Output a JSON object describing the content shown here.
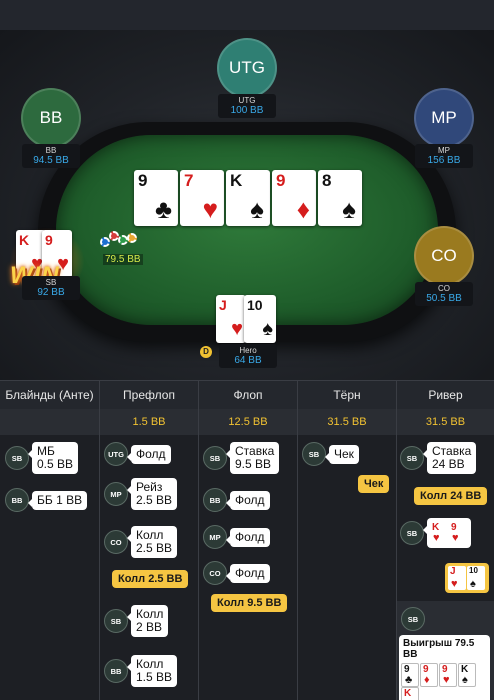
{
  "table": {
    "seats": {
      "utg": {
        "avatar": "UTG",
        "name": "UTG",
        "stack": "100 BB"
      },
      "bb": {
        "avatar": "BB",
        "name": "BB",
        "stack": "94.5 BB"
      },
      "mp": {
        "avatar": "MP",
        "name": "MP",
        "stack": "156 BB"
      },
      "co": {
        "avatar": "CO",
        "name": "CO",
        "stack": "50.5 BB"
      },
      "sb": {
        "name": "SB",
        "stack": "92 BB",
        "win_label": "WIN"
      },
      "hero": {
        "name": "Hero",
        "stack": "64 BB",
        "dealer": "D"
      }
    },
    "board": [
      {
        "rank": "9",
        "suit": "♣",
        "color": "#111111"
      },
      {
        "rank": "7",
        "suit": "♥",
        "color": "#d51d1d"
      },
      {
        "rank": "K",
        "suit": "♠",
        "color": "#111111"
      },
      {
        "rank": "9",
        "suit": "♦",
        "color": "#d51d1d"
      },
      {
        "rank": "8",
        "suit": "♠",
        "color": "#111111"
      }
    ],
    "sb_cards": [
      {
        "rank": "K",
        "suit": "♥",
        "color": "#d51d1d"
      },
      {
        "rank": "9",
        "suit": "♥",
        "color": "#d51d1d"
      }
    ],
    "hero_cards": [
      {
        "rank": "J",
        "suit": "♥",
        "color": "#d51d1d"
      },
      {
        "rank": "10",
        "suit": "♠",
        "color": "#111111"
      }
    ],
    "pot": "79.5 BB"
  },
  "history": {
    "columns": [
      {
        "title": "Блайнды (Анте)",
        "pot": ""
      },
      {
        "title": "Префлоп",
        "pot": "1.5 BB"
      },
      {
        "title": "Флоп",
        "pot": "12.5 BB"
      },
      {
        "title": "Тёрн",
        "pot": "31.5 BB"
      },
      {
        "title": "Ривер",
        "pot": "31.5 BB"
      }
    ],
    "blinds": [
      {
        "pos": "SB",
        "line1": "МБ",
        "line2": "0.5 BB"
      },
      {
        "pos": "BB",
        "line1": "ББ 1 BB",
        "line2": ""
      }
    ],
    "preflop": [
      {
        "pos": "UTG",
        "line1": "Фолд",
        "line2": ""
      },
      {
        "pos": "MP",
        "line1": "Рейз",
        "line2": "2.5 BB"
      },
      {
        "pos": "CO",
        "line1": "Колл",
        "line2": "2.5 BB"
      },
      {
        "pos": "SB",
        "line1": "Колл",
        "line2": "2 BB"
      },
      {
        "pos": "BB",
        "line1": "Колл",
        "line2": "1.5 BB"
      }
    ],
    "preflop_hero": "Колл 2.5 BB",
    "flop": [
      {
        "pos": "SB",
        "line1": "Ставка",
        "line2": "9.5 BB"
      },
      {
        "pos": "BB",
        "line1": "Фолд",
        "line2": ""
      },
      {
        "pos": "MP",
        "line1": "Фолд",
        "line2": ""
      },
      {
        "pos": "CO",
        "line1": "Фолд",
        "line2": ""
      }
    ],
    "flop_hero": "Колл 9.5 BB",
    "turn": [
      {
        "pos": "SB",
        "line1": "Чек",
        "line2": ""
      }
    ],
    "turn_hero": "Чек",
    "river": [
      {
        "pos": "SB",
        "line1": "Ставка",
        "line2": "24 BB"
      }
    ],
    "river_hero": "Колл 24 BB",
    "river_sb_show": {
      "pos": "SB",
      "cards": [
        {
          "rank": "K",
          "suit": "♥",
          "color": "#d51d1d"
        },
        {
          "rank": "9",
          "suit": "♥",
          "color": "#d51d1d"
        }
      ]
    },
    "river_hero_show": [
      {
        "rank": "J",
        "suit": "♥",
        "color": "#d51d1d"
      },
      {
        "rank": "10",
        "suit": "♠",
        "color": "#111111"
      }
    ],
    "result": {
      "pos": "SB",
      "title": "Выигрыш 79.5 BB",
      "cards": [
        {
          "rank": "9",
          "suit": "♣",
          "color": "#111111"
        },
        {
          "rank": "9",
          "suit": "♦",
          "color": "#d51d1d"
        },
        {
          "rank": "9",
          "suit": "♥",
          "color": "#d51d1d"
        },
        {
          "rank": "K",
          "suit": "♠",
          "color": "#111111"
        },
        {
          "rank": "K",
          "suit": "♥",
          "color": "#d51d1d"
        }
      ]
    }
  }
}
